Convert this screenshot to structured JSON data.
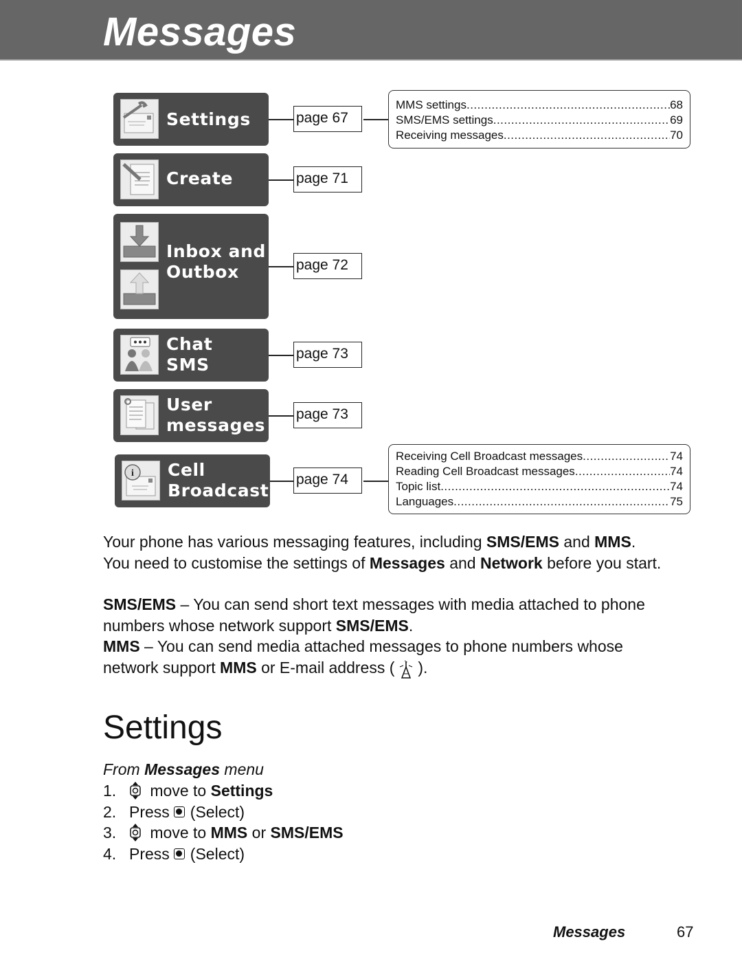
{
  "header": {
    "title": "Messages"
  },
  "menu": [
    {
      "label_lines": [
        "Settings"
      ],
      "icon": "settings-envelope-wrench-icon",
      "page_label": "page 67"
    },
    {
      "label_lines": [
        "Create"
      ],
      "icon": "create-document-pencil-icon",
      "page_label": "page 71"
    },
    {
      "label_lines": [
        "Inbox and",
        "Outbox"
      ],
      "icon": "inbox-tray-down-arrow-icon",
      "icon2": "outbox-tray-up-arrow-icon",
      "page_label": "page 72"
    },
    {
      "label_lines": [
        "Chat",
        "SMS"
      ],
      "icon": "chat-people-bubble-icon",
      "page_label": "page 73"
    },
    {
      "label_lines": [
        "User",
        "messages"
      ],
      "icon": "user-messages-documents-icon",
      "page_label": "page 73"
    },
    {
      "label_lines": [
        "Cell",
        "Broadcast"
      ],
      "icon": "cell-broadcast-info-envelope-icon",
      "page_label": "page 74"
    }
  ],
  "toc_settings": [
    {
      "title": "MMS settings",
      "page": "68"
    },
    {
      "title": "SMS/EMS settings",
      "page": "69"
    },
    {
      "title": "Receiving messages",
      "page": "70"
    }
  ],
  "toc_cell_broadcast": [
    {
      "title": "Receiving Cell Broadcast messages ",
      "page": "74"
    },
    {
      "title": "Reading Cell Broadcast messages",
      "page": "74"
    },
    {
      "title": "Topic list ",
      "page": "74"
    },
    {
      "title": "Languages ",
      "page": "75"
    }
  ],
  "intro": {
    "line1_a": "Your phone has various messaging features, including ",
    "line1_b": "SMS/EMS",
    "line1_c": " and ",
    "line1_d": "MMS",
    "line1_e": ".",
    "line2_a": "You need to customise the settings of ",
    "line2_b": "Messages",
    "line2_c": " and ",
    "line2_d": "Network",
    "line2_e": " before you start."
  },
  "sms_para": {
    "term": "SMS/EMS",
    "text": " – You can send short text messages with media attached to phone numbers whose network support ",
    "term2": "SMS/EMS",
    "end": "."
  },
  "mms_para": {
    "term": "MMS",
    "text": " – You can send media attached messages to phone numbers whose network support ",
    "term2": "MMS",
    "text2": " or E-mail address (",
    "end": ")."
  },
  "section": {
    "title": "Settings",
    "from_a": "From ",
    "from_b": "Messages",
    "from_c": " menu",
    "steps": [
      {
        "num": "1.",
        "key": "navigation-key",
        "text_a": " move to ",
        "text_b": "Settings",
        "text_c": "",
        "text_d": ""
      },
      {
        "num": "2.",
        "pre": "Press",
        "key": "select-key",
        "text_a": "(Select)"
      },
      {
        "num": "3.",
        "key": "navigation-key",
        "text_a": " move to ",
        "text_b": "MMS",
        "text_c": " or ",
        "text_d": "SMS/EMS"
      },
      {
        "num": "4.",
        "pre": "Press",
        "key": "select-key",
        "text_a": "(Select)"
      }
    ]
  },
  "footer": {
    "section": "Messages",
    "page": "67"
  }
}
